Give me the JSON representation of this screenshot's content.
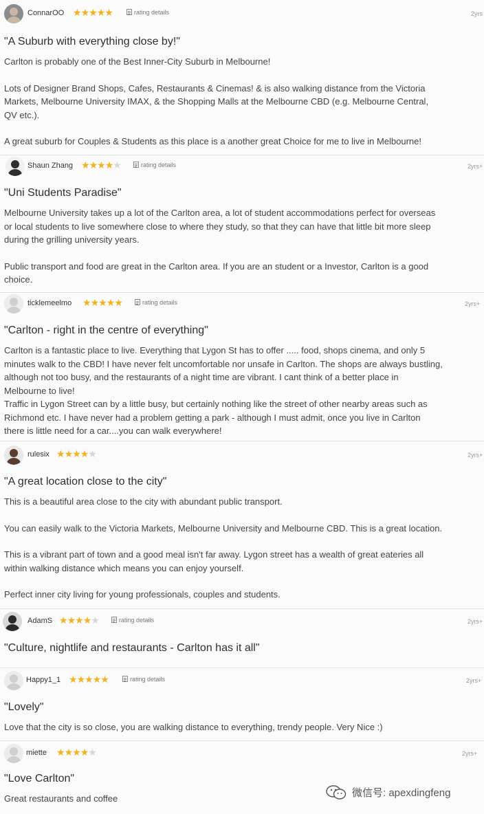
{
  "reviews": [
    {
      "username": "ConnarOO",
      "rating": 5,
      "rating_details": "rating details",
      "age": "2yrs",
      "title": "\"A Suburb with everything close by!\"",
      "body": [
        "Carlton is probably one of the Best Inner-City Suburb in Melbourne!",
        "",
        "Lots of Designer Brand Shops, Cafes, Restaurants & Cinemas! & is also walking distance from the Victoria",
        "Markets, Melbourne University IMAX, & the Shopping Malls at the Melbourne CBD (e.g. Melbourne Central,",
        "QV etc.).",
        "",
        "A great suburb for Couples & Students as this place is a another great Choice for me to live in Melbourne!"
      ]
    },
    {
      "username": "Shaun Zhang",
      "rating": 4,
      "rating_details": "rating details",
      "age": "2yrs+",
      "title": "\"Uni Students Paradise\"",
      "body": [
        "Melbourne University takes up a lot of the Carlton area, a lot of student accommodations perfect for overseas",
        "or local students to live somewhere close to where they study, so that they can have that little bit more sleep",
        "during the grilling university years.",
        "",
        "Public transport and food are great in the Carlton area. If you are an student or a Investor, Carlton is a good",
        "choice."
      ]
    },
    {
      "username": "ticklemeelmo",
      "rating": 5,
      "rating_details": "rating details",
      "age": "2yrs+",
      "title": "\"Carlton - right in the centre of everything\"",
      "body": [
        "Carlton is a fantastic place to live. Everything that Lygon St has to offer ..... food, shops cinema, and only 5",
        "minutes walk to the CBD! I have never felt uncomfortable nor unsafe in Carlton. The shops are always bustling,",
        "although not too busy, and the restaurants of a night time are vibrant. I cant think of a better place in",
        "Melbourne to live!",
        "Traffic in Lygon Street can by a little busy, but certainly nothing like the street of other nearby areas such as",
        "Richmond etc. I have never had a problem getting a park - although I must admit, once you live in Carlton",
        "there is little need for a car....you can walk everywhere!"
      ]
    },
    {
      "username": "rulesix",
      "rating": 4,
      "rating_details": "",
      "age": "2yrs+",
      "title": "\"A great location close to the city\"",
      "body": [
        "This is a beautiful area close to the city with abundant public transport.",
        "",
        "You can easily walk to the Victoria Markets, Melbourne University and Melbourne CBD. This is a great location.",
        "",
        "This is a vibrant part of town and a good meal isn't far away. Lygon street has a wealth of great eateries all",
        "within walking distance which means you can enjoy yourself.",
        "",
        "Perfect inner city living for young professionals, couples and students."
      ]
    },
    {
      "username": "AdamS",
      "rating": 4,
      "rating_details": "rating details",
      "age": "2yrs+",
      "title": "\"Culture, nightlife and restaurants - Carlton has it all\"",
      "body": []
    },
    {
      "username": "Happy1_1",
      "rating": 5,
      "rating_details": "rating details",
      "age": "2yrs+",
      "title": "\"Lovely\"",
      "body": [
        "Love that the city is so close, you are walking distance to everything, trendy people. Very Nice :)"
      ]
    },
    {
      "username": "miette",
      "rating": 4,
      "rating_details": "",
      "age": "2yrs+",
      "title": "\"Love Carlton\"",
      "body": [
        "Great restaurants and coffee"
      ]
    }
  ],
  "watermark": {
    "text": "微信号: apexdingfeng",
    "icon": "wechat-bubble-icon"
  },
  "colors": {
    "star_on": "#f2b21b",
    "star_off": "#d6d6d6",
    "background": "#fbfbfb"
  }
}
